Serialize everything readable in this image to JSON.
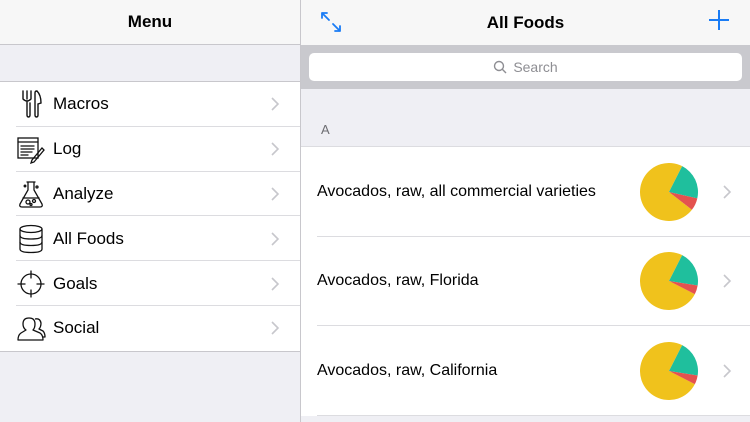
{
  "left": {
    "title": "Menu",
    "items": [
      {
        "label": "Macros",
        "icon": "fork-knife-icon"
      },
      {
        "label": "Log",
        "icon": "log-pencil-icon"
      },
      {
        "label": "Analyze",
        "icon": "flask-icon"
      },
      {
        "label": "All Foods",
        "icon": "database-icon"
      },
      {
        "label": "Goals",
        "icon": "crosshair-icon"
      },
      {
        "label": "Social",
        "icon": "people-icon"
      }
    ]
  },
  "right": {
    "title": "All Foods",
    "search_placeholder": "Search",
    "section": "A",
    "foods": [
      {
        "name": "Avocados, raw, all commercial varieties",
        "chart": {
          "type": "pie",
          "values": [
            72,
            21,
            7
          ],
          "colors": [
            "#f0c21c",
            "#1fbf9d",
            "#e4524f"
          ]
        }
      },
      {
        "name": "Avocados, raw, Florida",
        "chart": {
          "type": "pie",
          "values": [
            75,
            20,
            5
          ],
          "colors": [
            "#f0c21c",
            "#1fbf9d",
            "#e4524f"
          ]
        }
      },
      {
        "name": "Avocados, raw, California",
        "chart": {
          "type": "pie",
          "values": [
            75,
            20,
            5
          ],
          "colors": [
            "#f0c21c",
            "#1fbf9d",
            "#e4524f"
          ]
        }
      }
    ]
  },
  "colors": {
    "accent": "#1a7cf5",
    "chevron": "#c7c7cc"
  }
}
